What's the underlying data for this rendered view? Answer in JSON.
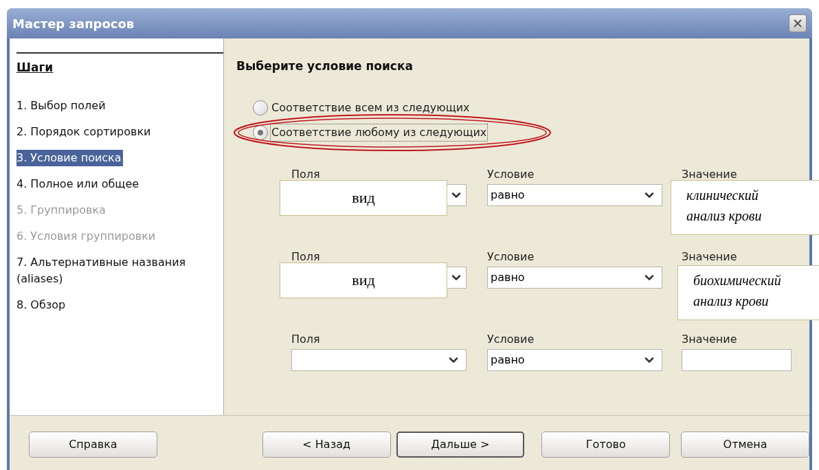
{
  "window": {
    "title": "Мастер запросов"
  },
  "steps": {
    "title": "Шаги",
    "items": [
      {
        "label": "1. Выбор полей",
        "selected": false,
        "disabled": false
      },
      {
        "label": "2. Порядок сортировки",
        "selected": false,
        "disabled": false
      },
      {
        "label": "3. Условие поиска",
        "selected": true,
        "disabled": false
      },
      {
        "label": "4. Полное или общее",
        "selected": false,
        "disabled": false
      },
      {
        "label": "5. Группировка",
        "selected": false,
        "disabled": true
      },
      {
        "label": "6. Условия группировки",
        "selected": false,
        "disabled": true
      },
      {
        "label": "7. Альтернативные названия (aliases)",
        "selected": false,
        "disabled": false
      },
      {
        "label": "8. Обзор",
        "selected": false,
        "disabled": false
      }
    ]
  },
  "page": {
    "heading": "Выберите условие поиска",
    "match_options": [
      {
        "label": "Соответствие всем из следующих",
        "selected": false,
        "circled": false
      },
      {
        "label": "Соответствие любому из следующих",
        "selected": true,
        "circled": true
      }
    ],
    "conditions": [
      {
        "field_label": "Поля",
        "field_note": "вид",
        "condition_label": "Условие",
        "condition_value": "равно",
        "value_label": "Значение",
        "value_note": "клинический анализ крови"
      },
      {
        "field_label": "Поля",
        "field_note": "вид",
        "condition_label": "Условие",
        "condition_value": "равно",
        "value_label": "Значение",
        "value_note": "биохимический анализ крови"
      },
      {
        "field_label": "Поля",
        "condition_label": "Условие",
        "condition_value": "равно",
        "value_label": "Значение"
      }
    ]
  },
  "buttons": [
    {
      "label": "Справка",
      "default": false
    },
    {
      "label": "< Назад",
      "default": false
    },
    {
      "label": "Дальше >",
      "default": true
    },
    {
      "label": "Готово",
      "default": false
    },
    {
      "label": "Отмена",
      "default": false
    }
  ]
}
